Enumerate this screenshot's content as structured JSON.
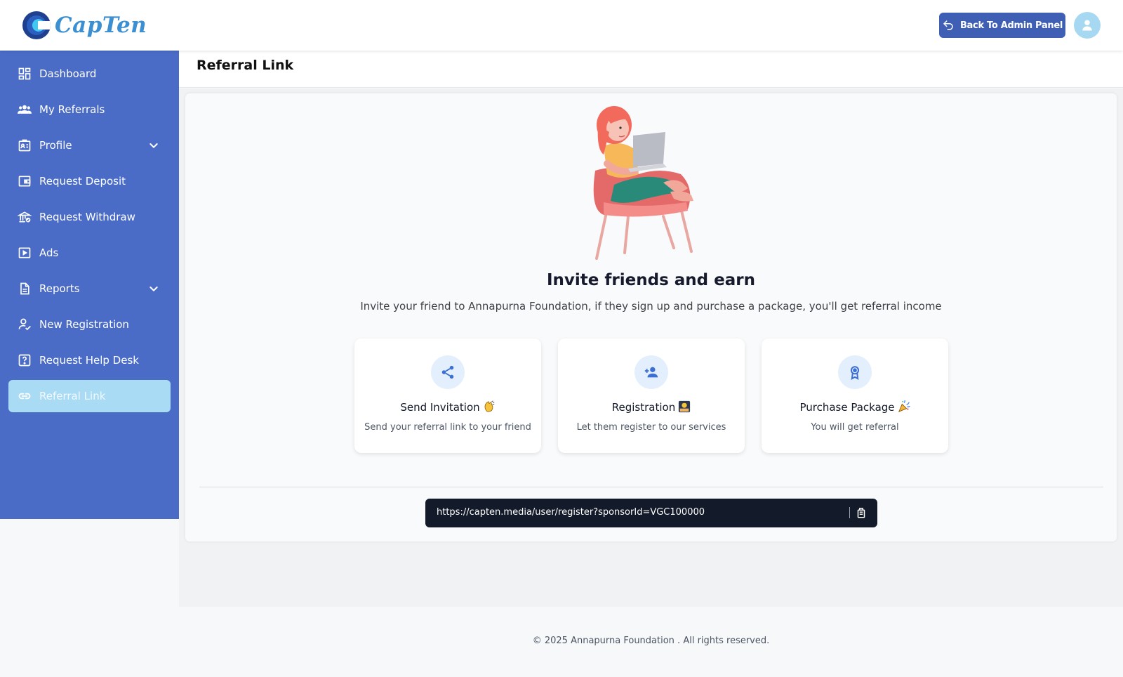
{
  "header": {
    "brand": "CapTen",
    "admin_button": "Back To Admin Panel"
  },
  "sidebar": {
    "items": [
      {
        "label": "Dashboard",
        "icon": "dashboard-icon"
      },
      {
        "label": "My Referrals",
        "icon": "users-icon"
      },
      {
        "label": "Profile",
        "icon": "id-card-icon",
        "expandable": true
      },
      {
        "label": "Request Deposit",
        "icon": "wallet-icon"
      },
      {
        "label": "Request Withdraw",
        "icon": "bank-icon"
      },
      {
        "label": "Ads",
        "icon": "play-icon"
      },
      {
        "label": "Reports",
        "icon": "document-icon",
        "expandable": true
      },
      {
        "label": "New Registration",
        "icon": "user-check-icon"
      },
      {
        "label": "Request Help Desk",
        "icon": "help-icon"
      },
      {
        "label": "Referral Link",
        "icon": "link-icon",
        "active": true
      }
    ]
  },
  "page": {
    "title": "Referral Link",
    "headline": "Invite friends and earn",
    "subline": "Invite your friend to Annapurna Foundation, if they sign up and purchase a package, you'll get referral income",
    "steps": [
      {
        "title": "Send Invitation",
        "desc": "Send your referral link to your friend",
        "icon": "share-icon",
        "emoji": "clapping-hands"
      },
      {
        "title": "Registration",
        "desc": "Let them register to our services",
        "icon": "add-user-icon",
        "emoji": "person-at-computer"
      },
      {
        "title": "Purchase Package",
        "desc": "You will get referral",
        "icon": "award-icon",
        "emoji": "party-popper"
      }
    ],
    "referral_url": "https://capten.media/user/register?sponsorId=VGC100000"
  },
  "footer": {
    "text": "© 2025 Annapurna Foundation . All rights reserved."
  },
  "colors": {
    "sidebar": "#4a6cc7",
    "active_item": "#a9dbf5",
    "primary_button": "#3e5fb3",
    "link_bar": "#131a2a"
  }
}
